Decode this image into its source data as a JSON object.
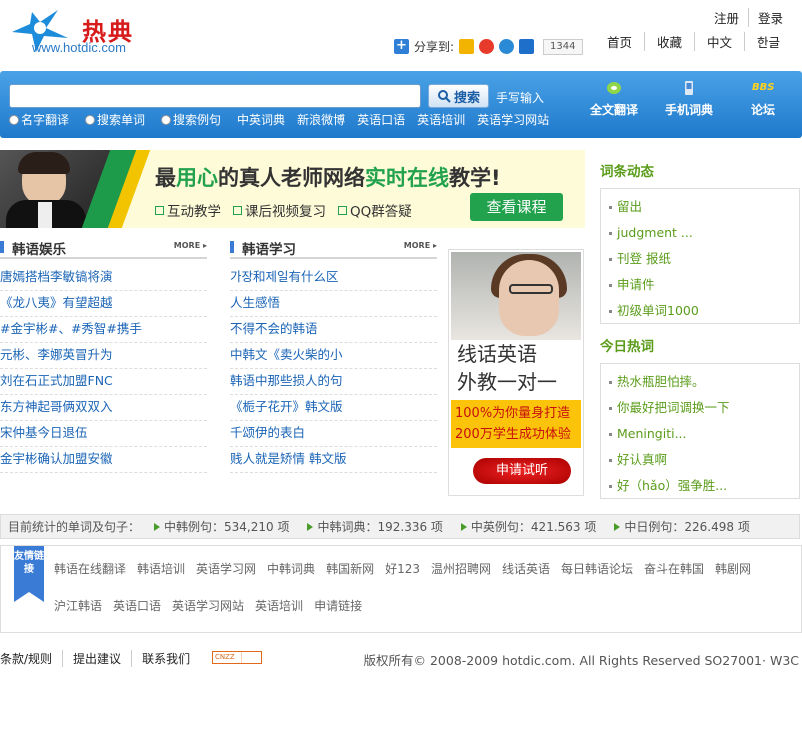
{
  "header": {
    "logo_cn": "热典",
    "logo_url": "www.hotdic.com",
    "top_links": [
      "注册",
      "登录"
    ],
    "nav_links": [
      "首页",
      "收藏",
      "中文",
      "한글"
    ],
    "share_label": "分享到:",
    "share_count": "1344"
  },
  "search": {
    "placeholder": "",
    "button_label": "搜索",
    "handwrite_label": "手写输入",
    "options": [
      "名字翻译",
      "搜索单词",
      "搜索例句"
    ],
    "links": [
      "中英词典",
      "新浪微博",
      "英语口语",
      "英语培训",
      "英语学习网站"
    ],
    "tools": [
      "全文翻译",
      "手机词典",
      "论坛"
    ],
    "bbs_badge": "BBS"
  },
  "banner": {
    "headline_a": "最",
    "headline_b": "用心",
    "headline_c": "的真人老师网络",
    "headline_d": "实时在线",
    "headline_e": "教学!",
    "features": [
      "互动教学",
      "课后视频复习",
      "QQ群答疑"
    ],
    "cta": "查看课程"
  },
  "columns": [
    {
      "title": "韩语娱乐",
      "more": "MORE",
      "items": [
        "唐嫣搭档李敏镐将演",
        "《龙八夷》有望超越",
        "#金宇彬#、#秀智#携手",
        "元彬、李娜英冒升为",
        "刘在石正式加盟FNC",
        "东方神起哥俩双双入",
        "宋仲基今日退伍",
        "金宇彬确认加盟安徽"
      ]
    },
    {
      "title": "韩语学习",
      "more": "MORE",
      "items": [
        "가장和제일有什么区",
        "人生感悟",
        "不得不会的韩语",
        "中韩文《卖火柴的小",
        "韩语中那些损人的句",
        "《栀子花开》韩文版",
        "千颂伊的表白",
        "贱人就是矫情 韩文版"
      ]
    }
  ],
  "ad": {
    "line1": "线话英语",
    "line2": "外教一对一",
    "promo1": "100%为你量身打造",
    "promo2": "200万学生成功体验",
    "apply": "申请试听"
  },
  "sidebar": {
    "dynamics_title": "词条动态",
    "dynamics": [
      "留出",
      "judgment ...",
      "刊登 报纸",
      "申请件",
      "初级单词1000"
    ],
    "hot_title": "今日热词",
    "hot": [
      "热水瓶胆怕摔。",
      "你最好把词调换一下",
      "Meningiti...",
      "好认真啊",
      "好（hǎo）强争胜..."
    ]
  },
  "stats": {
    "label": "目前统计的单词及句子：",
    "items": [
      "中韩例句：534,210 项",
      "中韩词典：192.336 项",
      "中英例句：421.563 项",
      "中日例句：226.498 项"
    ]
  },
  "friends": {
    "badge": "友情链接",
    "links": [
      "韩语在线翻译",
      "韩语培训",
      "英语学习网",
      "中韩词典",
      "韩国新网",
      "好123",
      "温州招聘网",
      "线话英语",
      "每日韩语论坛",
      "奋斗在韩国",
      "韩剧网",
      "沪江韩语",
      "英语口语",
      "英语学习网站",
      "英语培训",
      "申请链接"
    ]
  },
  "footer": {
    "links": [
      "条款/规则",
      "提出建议",
      "联系我们"
    ],
    "cnzz": "CNZZ",
    "copyright": "版权所有© 2008-2009 hotdic.com. All Rights Reserved SO27001· W3C"
  },
  "colors": {
    "accent_blue": "#1f79cc",
    "link_blue": "#1a64b6",
    "green": "#5a9c1a",
    "logo_red": "#d71a1a"
  }
}
